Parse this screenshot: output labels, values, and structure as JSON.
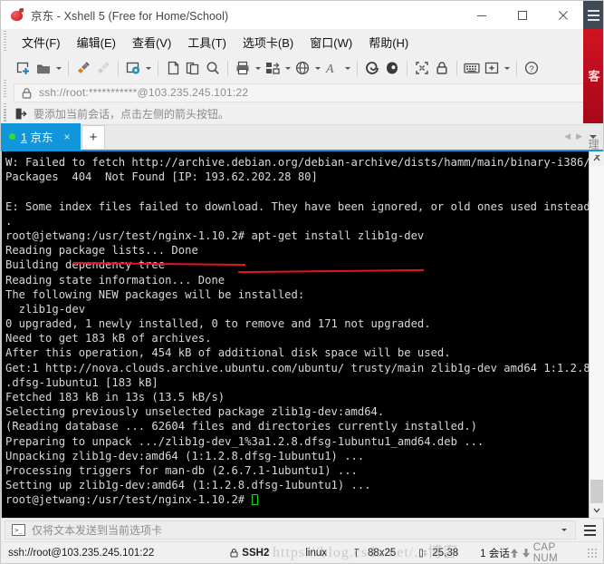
{
  "window": {
    "title": "京东 - Xshell 5 (Free for Home/School)",
    "minimize_label": "最小化",
    "maximize_label": "最大化",
    "close_label": "关闭"
  },
  "menu": {
    "items": [
      {
        "label": "文件(F)",
        "name": "menu-file"
      },
      {
        "label": "编辑(E)",
        "name": "menu-edit"
      },
      {
        "label": "查看(V)",
        "name": "menu-view"
      },
      {
        "label": "工具(T)",
        "name": "menu-tools"
      },
      {
        "label": "选项卡(B)",
        "name": "menu-tabs"
      },
      {
        "label": "窗口(W)",
        "name": "menu-window"
      },
      {
        "label": "帮助(H)",
        "name": "menu-help"
      }
    ]
  },
  "toolbar": {
    "overflow_label": "»",
    "icons": [
      "new-session-icon",
      "open-folder-icon",
      "connect-icon",
      "disconnect-icon",
      "properties-icon",
      "copy-icon",
      "paste-icon",
      "find-icon",
      "print-icon",
      "layout-icon",
      "globe-icon",
      "font-icon",
      "session-manager-icon",
      "highlight-icon",
      "fullscreen-icon",
      "lock-icon",
      "keyboard-icon",
      "add-icon",
      "help-icon"
    ]
  },
  "address": {
    "value": "ssh://root:***********@103.235.245.101:22",
    "lock_icon": "lock-icon"
  },
  "notice": {
    "text": "要添加当前会话，点击左侧的箭头按钮。",
    "icon": "add-session-arrow-icon"
  },
  "tabs": {
    "active": {
      "index": "1",
      "label": "京东",
      "close_label": "×",
      "status_dot_color": "#2ee02e"
    },
    "new_tab_label": "+",
    "prev_label": "◀",
    "next_label": "▶"
  },
  "terminal": {
    "lines": [
      "W: Failed to fetch http://archive.debian.org/debian-archive/dists/hamm/main/binary-i386/",
      "Packages  404  Not Found [IP: 193.62.202.28 80]",
      "",
      "E: Some index files failed to download. They have been ignored, or old ones used instead",
      ".",
      "root@jetwang:/usr/test/nginx-1.10.2# apt-get install zlib1g-dev",
      "Reading package lists... Done",
      "Building dependency tree",
      "Reading state information... Done",
      "The following NEW packages will be installed:",
      "  zlib1g-dev",
      "0 upgraded, 1 newly installed, 0 to remove and 171 not upgraded.",
      "Need to get 183 kB of archives.",
      "After this operation, 454 kB of additional disk space will be used.",
      "Get:1 http://nova.clouds.archive.ubuntu.com/ubuntu/ trusty/main zlib1g-dev amd64 1:1.2.8",
      ".dfsg-1ubuntu1 [183 kB]",
      "Fetched 183 kB in 13s (13.5 kB/s)",
      "Selecting previously unselected package zlib1g-dev:amd64.",
      "(Reading database ... 62604 files and directories currently installed.)",
      "Preparing to unpack .../zlib1g-dev_1%3a1.2.8.dfsg-1ubuntu1_amd64.deb ...",
      "Unpacking zlib1g-dev:amd64 (1:1.2.8.dfsg-1ubuntu1) ...",
      "Processing triggers for man-db (2.6.7.1-1ubuntu1) ...",
      "Setting up zlib1g-dev:amd64 (1:1.2.8.dfsg-1ubuntu1) ..."
    ],
    "prompt": "root@jetwang:/usr/test/nginx-1.10.2# ",
    "annotation_color": "#e3141b",
    "background": "#000000",
    "foreground": "#d8d8d8"
  },
  "send_to": {
    "text": "仅将文本发送到当前选项卡",
    "icon": "terminal-prompt-icon"
  },
  "status": {
    "url": "ssh://root@103.235.245.101:22",
    "protocol": "SSH2",
    "terminal_type": "linux",
    "size": "88x25",
    "cursor": "25,38",
    "sessions": "1 会话",
    "caps": "CAP NUM"
  },
  "side_banner": {
    "text": "客",
    "extra": "理"
  },
  "watermark": {
    "text": "https://blog.csdn.net/...博客"
  }
}
